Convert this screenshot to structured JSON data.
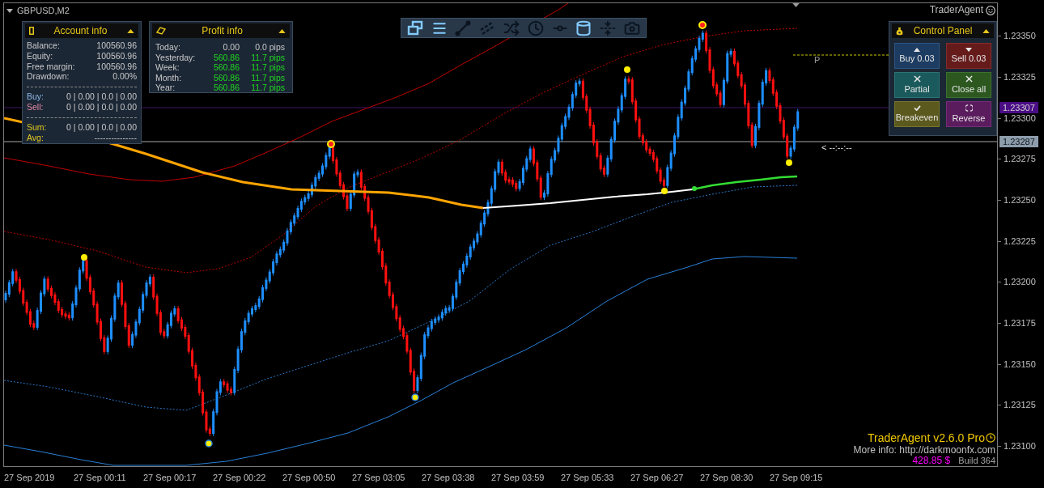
{
  "chart": {
    "symbol": "GBPUSD,M2",
    "expert": "TraderAgent",
    "pivot_label": "P",
    "timer": "< --:--:--"
  },
  "account_info": {
    "title": "Account info",
    "rows": [
      {
        "label": "Balance:",
        "value": "100560.96"
      },
      {
        "label": "Equity:",
        "value": "100560.96"
      },
      {
        "label": "Free margin:",
        "value": "100560.96"
      },
      {
        "label": "Drawdown:",
        "value": "0.00%"
      }
    ],
    "positions": [
      {
        "kind": "buy",
        "label": "Buy:",
        "value": "0 | 0.00 | 0.0 | 0.00"
      },
      {
        "kind": "sell",
        "label": "Sell:",
        "value": "0 | 0.00 | 0.0 | 0.00"
      }
    ],
    "totals": [
      {
        "label": "Sum:",
        "value": "0 | 0.00 | 0.0 | 0.00"
      },
      {
        "label": "Avg:",
        "value": "---------------"
      }
    ]
  },
  "profit_info": {
    "title": "Profit info",
    "rows": [
      {
        "label": "Today:",
        "amount": "0.00",
        "pips": "0.0 pips",
        "in_profit": false
      },
      {
        "label": "Yesterday:",
        "amount": "560.86",
        "pips": "11.7 pips",
        "in_profit": true
      },
      {
        "label": "Week:",
        "amount": "560.86",
        "pips": "11.7 pips",
        "in_profit": true
      },
      {
        "label": "Month:",
        "amount": "560.86",
        "pips": "11.7 pips",
        "in_profit": true
      },
      {
        "label": "Year:",
        "amount": "560.86",
        "pips": "11.7 pips",
        "in_profit": true
      }
    ]
  },
  "toolbar": {
    "buttons": [
      {
        "on": true
      },
      {
        "on": true
      },
      {
        "on": false
      },
      {
        "on": false
      },
      {
        "on": false
      },
      {
        "on": false
      },
      {
        "on": false
      },
      {
        "on": true
      },
      {
        "on": false
      },
      {
        "on": false
      }
    ]
  },
  "control_panel": {
    "title": "Control Panel",
    "buttons": [
      {
        "kind": "buy",
        "label": "Buy 0.03"
      },
      {
        "kind": "sell",
        "label": "Sell 0.03"
      },
      {
        "kind": "partial",
        "label": "Partial"
      },
      {
        "kind": "close_all",
        "label": "Close all"
      },
      {
        "kind": "breakeven",
        "label": "Breakeven"
      },
      {
        "kind": "reverse",
        "label": "Reverse"
      }
    ]
  },
  "price_axis": {
    "labels": [
      "1.23350",
      "1.23325",
      "1.23300",
      "1.23275",
      "1.23250",
      "1.23225",
      "1.23200",
      "1.23175",
      "1.23150",
      "1.23125",
      "1.23100"
    ],
    "markers": [
      {
        "kind": "ask",
        "label": "1.23307"
      },
      {
        "kind": "bid",
        "label": "1.23287"
      }
    ]
  },
  "time_axis": {
    "labels": [
      "27 Sep 2019",
      "27 Sep 00:11",
      "27 Sep 00:17",
      "27 Sep 00:22",
      "27 Sep 00:50",
      "27 Sep 03:05",
      "27 Sep 03:38",
      "27 Sep 03:59",
      "27 Sep 05:33",
      "27 Sep 06:27",
      "27 Sep 08:30",
      "27 Sep 09:15"
    ]
  },
  "footer": {
    "title": "TraderAgent v2.6.0 Pro",
    "link": "More info: http://darkmoonfx.com",
    "balance": "428.85 $",
    "build": "Build 364"
  }
}
